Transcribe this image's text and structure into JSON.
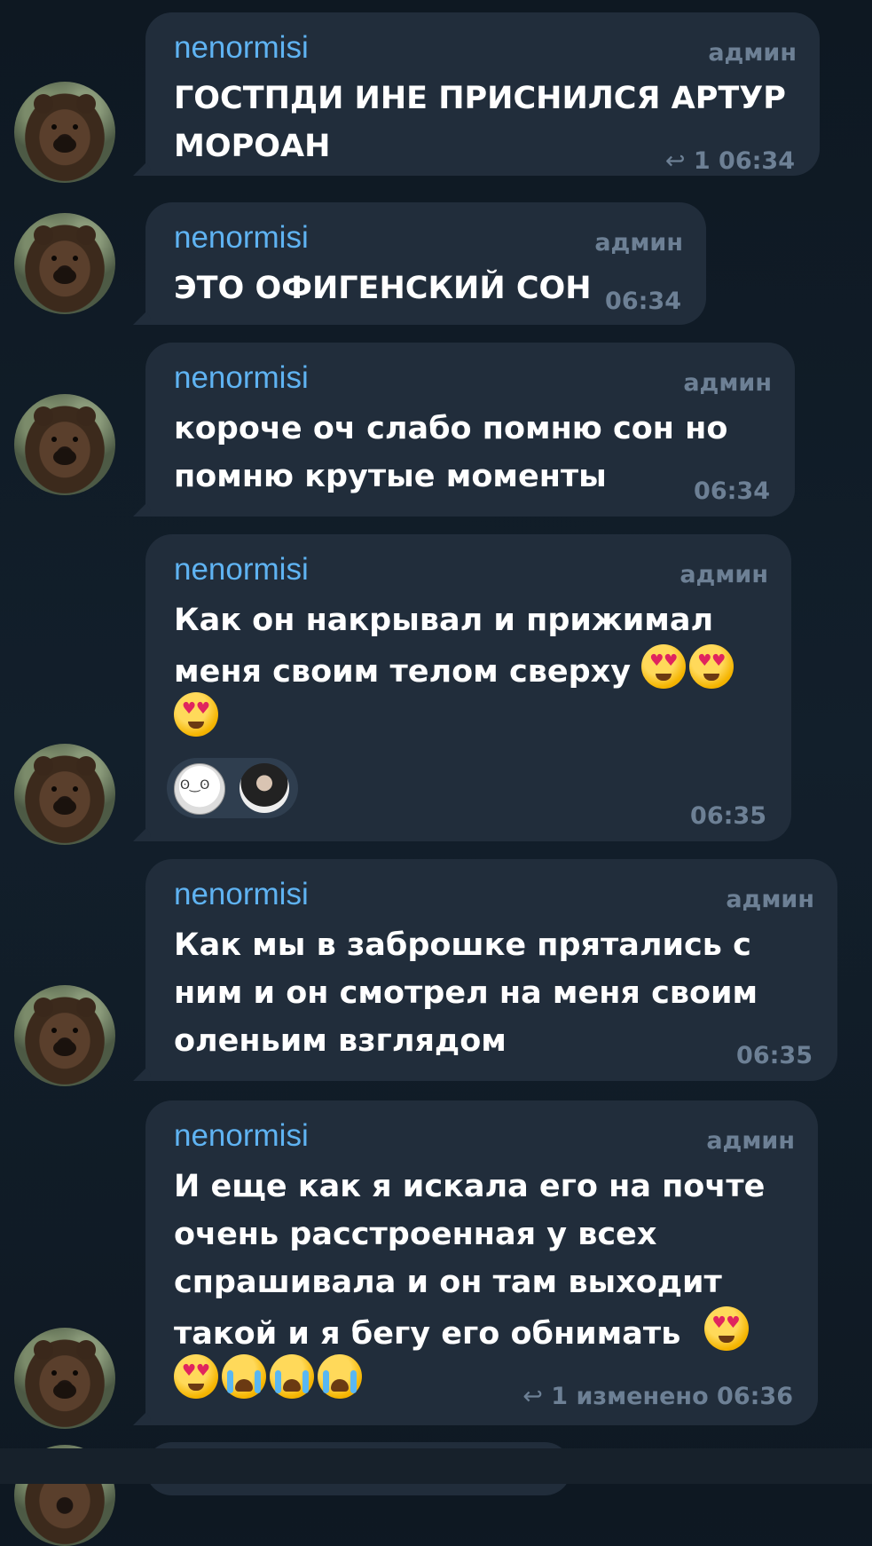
{
  "messages": [
    {
      "sender": "nenormisi",
      "badge": "админ",
      "lines": [
        "ГОСТПДИ ИНЕ ПРИСНИЛСЯ АРТУР",
        "МОРОАН"
      ],
      "meta": "1 06:34",
      "reply_count": "1",
      "time": "06:34"
    },
    {
      "sender": "nenormisi",
      "badge": "админ",
      "lines": [
        "ЭТО ОФИГЕНСКИЙ СОН"
      ],
      "time": "06:34"
    },
    {
      "sender": "nenormisi",
      "badge": "админ",
      "lines": [
        "короче оч слабо помню сон но",
        "помню крутые моменты"
      ],
      "time": "06:34"
    },
    {
      "sender": "nenormisi",
      "badge": "админ",
      "lines": [
        "Как он накрывал и прижимал",
        "меня своим телом сверху"
      ],
      "emoji_line1": [
        "smiling-face-with-heart-eyes",
        "smiling-face-with-heart-eyes"
      ],
      "emoji_line2": [
        "smiling-face-with-heart-eyes"
      ],
      "time": "06:35"
    },
    {
      "sender": "nenormisi",
      "badge": "админ",
      "lines": [
        "Как мы в заброшке прятались с",
        "ним и он смотрел на меня своим",
        "оленьим взглядом"
      ],
      "time": "06:35"
    },
    {
      "sender": "nenormisi",
      "badge": "админ",
      "lines": [
        "И еще как я искала его на почте",
        "очень расстроенная у всех",
        "спрашивала и он там выходит",
        "такой и я бегу его обнимать"
      ],
      "emoji_tail": [
        "smiling-face-with-heart-eyes",
        "smiling-face-with-heart-eyes",
        "loudly-crying-face",
        "loudly-crying-face",
        "loudly-crying-face"
      ],
      "reply_count": "1",
      "edited": "изменено",
      "time": "06:36"
    }
  ],
  "icons": {
    "reply": "reply-arrow-icon"
  }
}
